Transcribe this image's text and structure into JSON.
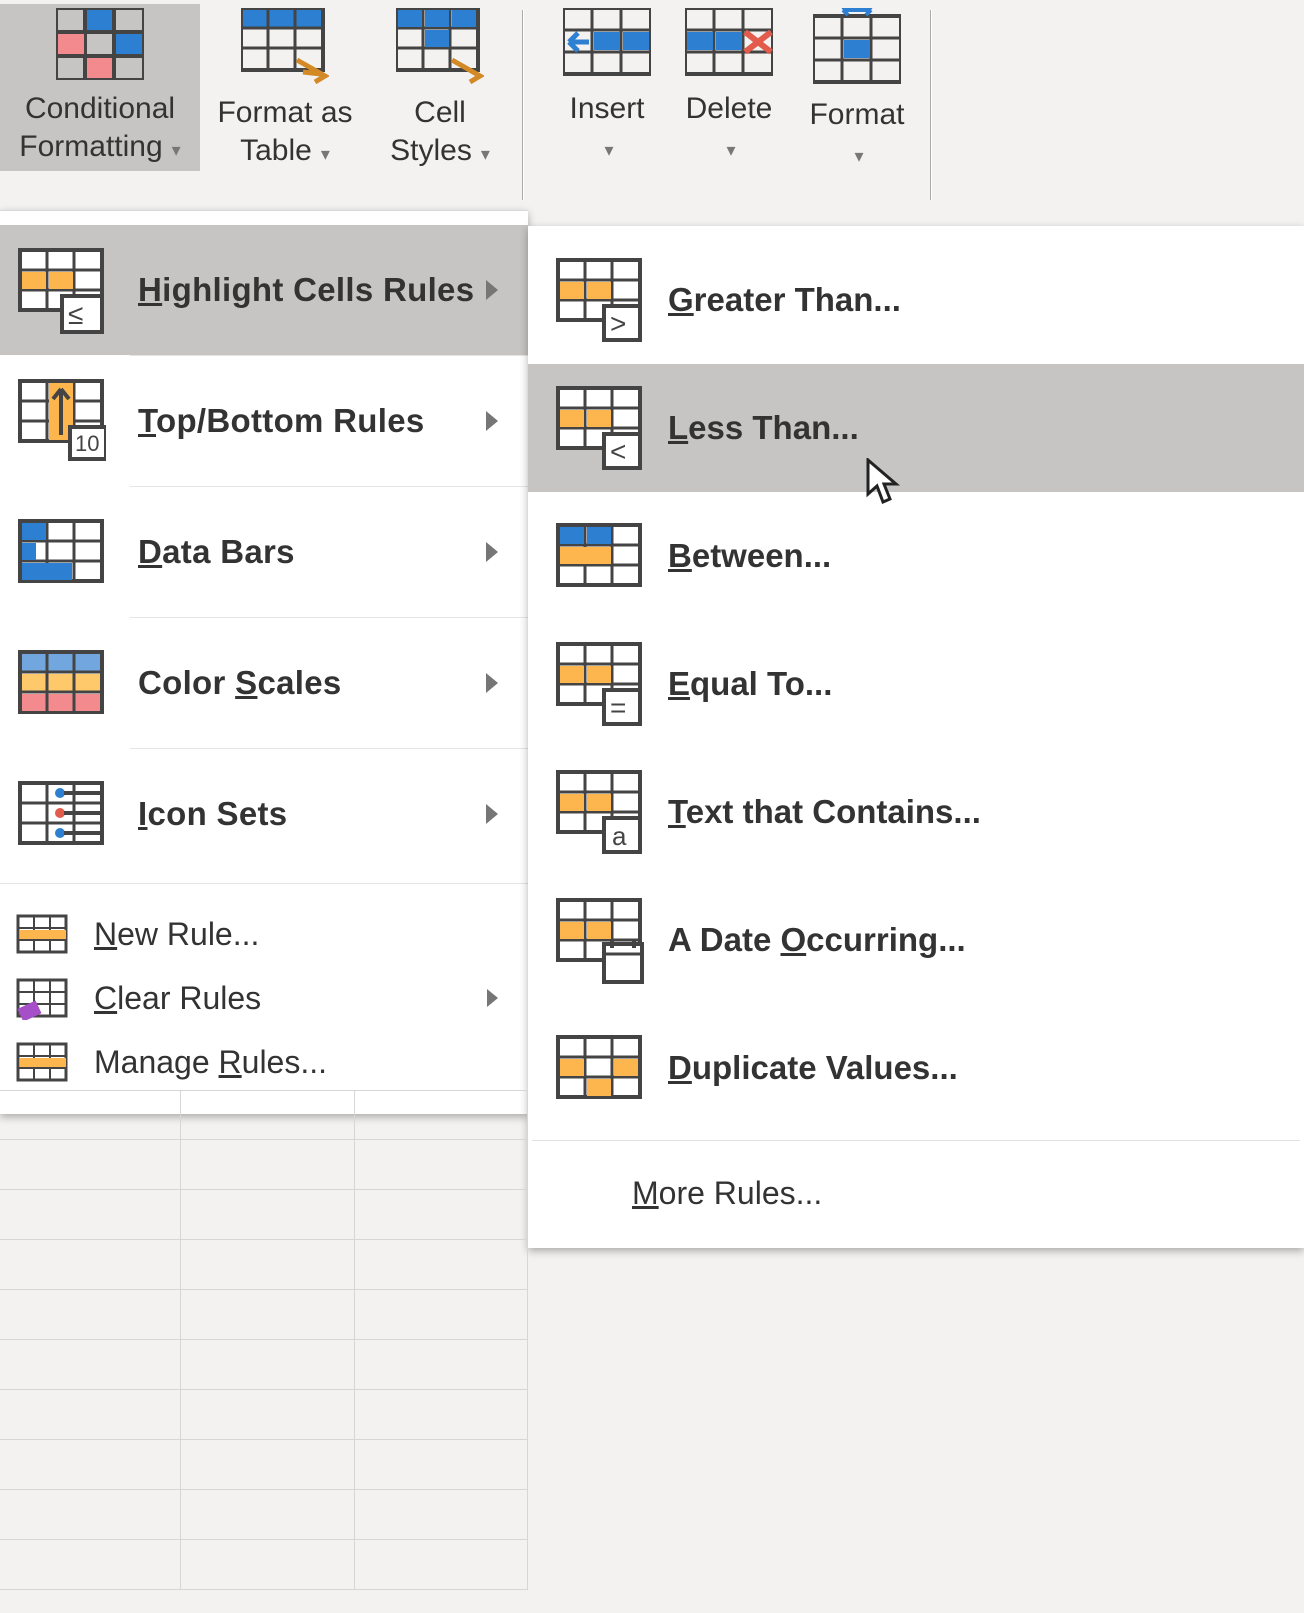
{
  "ribbon": {
    "conditional_formatting": "Conditional Formatting",
    "format_as_table": "Format as Table",
    "cell_styles": "Cell Styles",
    "insert": "Insert",
    "delete": "Delete",
    "format": "Format"
  },
  "menu1": {
    "highlight_cells_rules": "Highlight Cells Rules",
    "top_bottom_rules": "Top/Bottom Rules",
    "data_bars": "Data Bars",
    "color_scales": "Color Scales",
    "icon_sets": "Icon Sets",
    "new_rule": "New Rule...",
    "clear_rules": "Clear Rules",
    "manage_rules": "Manage Rules..."
  },
  "menu2": {
    "greater_than": "Greater Than...",
    "less_than": "Less Than...",
    "between": "Between...",
    "equal_to": "Equal To...",
    "text_that_contains": "Text that Contains...",
    "a_date_occurring": "A Date Occurring...",
    "duplicate_values": "Duplicate Values...",
    "more_rules": "More Rules..."
  }
}
